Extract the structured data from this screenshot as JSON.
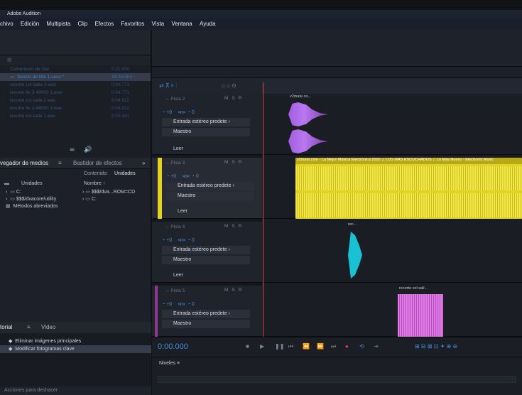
{
  "window": {
    "title": "Adobe Audition"
  },
  "menu": [
    "Archivo",
    "Edición",
    "Multipista",
    "Clip",
    "Efectos",
    "Favoritos",
    "Vista",
    "Ventana",
    "Ayuda"
  ],
  "files_panel": {
    "items": [
      {
        "name": "Comentario de Voz",
        "duration": "0:21.000"
      },
      {
        "name": "Sesión de Mix 1.sesx *",
        "duration": "43:34.953",
        "selected": true
      },
      {
        "name": "recorte col sabe 3.wav",
        "duration": "0:04.771"
      },
      {
        "name": "recorte fle 3-49000 1.wav",
        "duration": "0:04.771"
      },
      {
        "name": "recorte col salle 2.wav",
        "duration": "0:04.912"
      },
      {
        "name": "recorte fle 2-48000 1.wav",
        "duration": "0:04.912"
      },
      {
        "name": "recorte col salle 1.wav",
        "duration": "0:02.441"
      }
    ]
  },
  "media_browser": {
    "tab_media": "vegador de medios",
    "tab_effects": "Bastidor de efectos",
    "expand": "»",
    "content_label": "Contenido:",
    "units_label": "Unidades",
    "left_tree": [
      "Unidades",
      "C:",
      "$$$/dvacore/utility",
      "Métodos abreviados"
    ],
    "col_name": "Nombre",
    "right_tree": [
      "$$$/dva...ROM=CD",
      "C:"
    ]
  },
  "tutorial_panel": {
    "tab_tutorial": "torial",
    "tab_video": "Video",
    "items": [
      "Eliminar imágenes principales",
      "Modificar fotogramas clave",
      "Acciones para deshacer"
    ]
  },
  "tracks": [
    {
      "name": "Pista 2",
      "volume": "+0",
      "pan": "0",
      "input": "Entrada estéreo predete",
      "output": "Maestro",
      "extra": "Leer"
    },
    {
      "name": "Pista 3",
      "volume": "+0",
      "pan": "0",
      "input": "Entrada estéreo predete",
      "output": "Maestro",
      "extra": "Leer",
      "active": true
    },
    {
      "name": "Pista 4",
      "volume": "+0",
      "pan": "0",
      "input": "Entrada estéreo predete",
      "output": "Maestro",
      "extra": "Leer"
    },
    {
      "name": "Pista 5",
      "volume": "+0",
      "pan": "0",
      "input": "Entrada estéreo predete",
      "output": "Maestro",
      "extra": ""
    }
  ],
  "clips": {
    "track2": "v2mate.co...",
    "track3": "y2mate.com - La Mejor Música Electrónica 2020 ♫ LOS MAS ESCUCHADOS ♫ Lo Mas Nuevo - Electronic Music",
    "track4": "rec...",
    "track5": "recorte col sall..."
  },
  "transport": {
    "time": "0:00.000"
  },
  "levels": {
    "title": "Niveles"
  },
  "colors": {
    "clip_purple": "#a35ee0",
    "clip_yellow": "#e2d323",
    "clip_cyan": "#19c2d3",
    "clip_pink": "#e17be6",
    "accent_blue": "#3f8fdd",
    "playhead_red": "#e04545"
  }
}
